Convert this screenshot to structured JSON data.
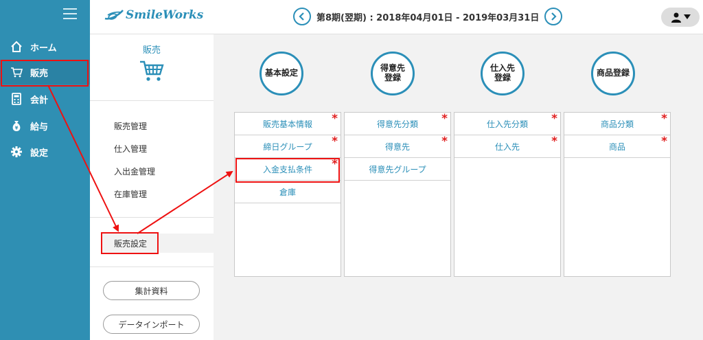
{
  "nav": {
    "items": [
      {
        "label": "ホーム",
        "icon": "home-icon"
      },
      {
        "label": "販売",
        "icon": "cart-icon"
      },
      {
        "label": "会計",
        "icon": "calculator-icon"
      },
      {
        "label": "給与",
        "icon": "money-bag-icon"
      },
      {
        "label": "設定",
        "icon": "gear-icon"
      }
    ]
  },
  "header": {
    "logo": "SmileWorks",
    "period": "第8期(翌期) : 2018年04月01日 - 2019年03月31日"
  },
  "subpanel": {
    "title": "販売",
    "links": [
      "販売管理",
      "仕入管理",
      "入出金管理",
      "在庫管理"
    ],
    "settings_tab": "販売設定",
    "buttons": [
      "集計資料",
      "データインポート"
    ]
  },
  "categories": [
    {
      "title": "基本設定",
      "rows": [
        {
          "label": "販売基本情報",
          "required": true
        },
        {
          "label": "締日グループ",
          "required": true
        },
        {
          "label": "入金支払条件",
          "required": true
        },
        {
          "label": "倉庫",
          "required": false
        }
      ]
    },
    {
      "title": "得意先\n登録",
      "rows": [
        {
          "label": "得意先分類",
          "required": true
        },
        {
          "label": "得意先",
          "required": true
        },
        {
          "label": "得意先グループ",
          "required": false
        }
      ]
    },
    {
      "title": "仕入先\n登録",
      "rows": [
        {
          "label": "仕入先分類",
          "required": true
        },
        {
          "label": "仕入先",
          "required": true
        }
      ]
    },
    {
      "title": "商品登録",
      "rows": [
        {
          "label": "商品分類",
          "required": true
        },
        {
          "label": "商品",
          "required": true
        }
      ]
    }
  ],
  "colors": {
    "accent": "#2b8fb8",
    "nav_bg": "#2f8fb3",
    "required": "#e02020",
    "highlight": "#e11111"
  }
}
